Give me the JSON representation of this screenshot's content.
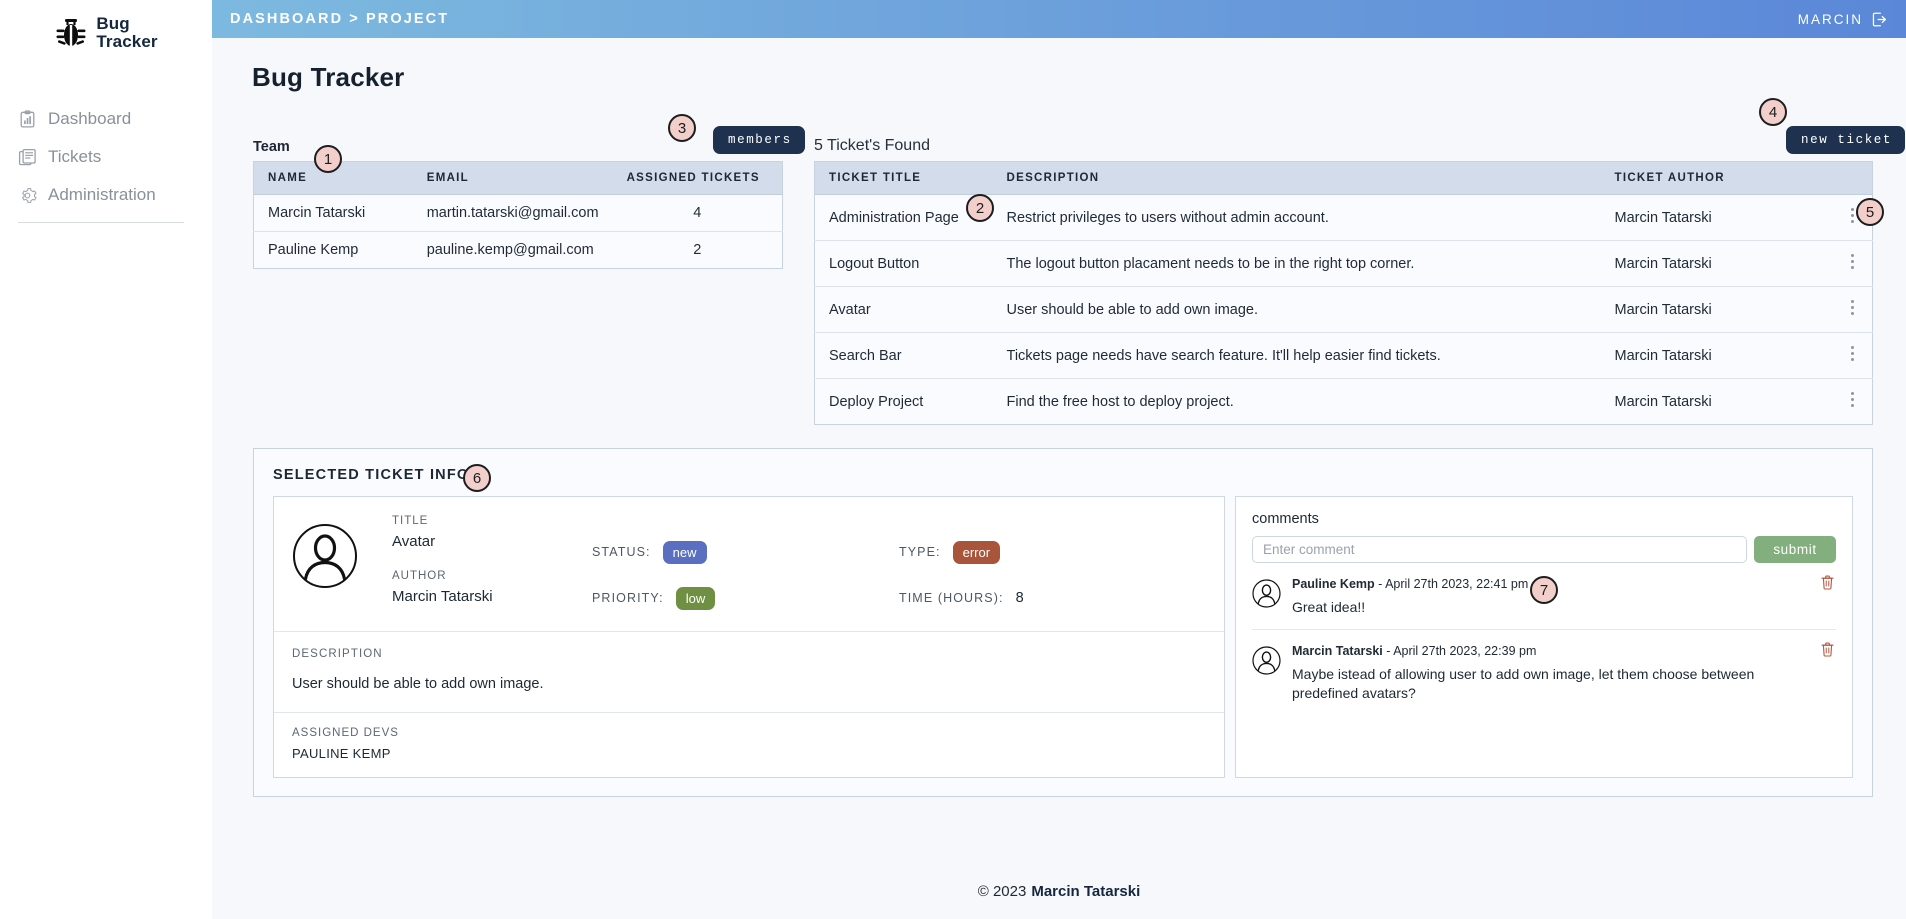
{
  "brand": {
    "line1": "Bug",
    "line2": "Tracker",
    "icon": "bug-icon"
  },
  "sidebar": {
    "items": [
      {
        "label": "Dashboard",
        "icon": "dashboard-chart-icon"
      },
      {
        "label": "Tickets",
        "icon": "ticket-list-icon"
      },
      {
        "label": "Administration",
        "icon": "gear-icon"
      }
    ]
  },
  "topbar": {
    "breadcrumb": "DASHBOARD > PROJECT",
    "user": "MARCIN",
    "logout_icon": "logout-icon",
    "gradient_from": "#7cb9e0",
    "gradient_to": "#5b87d8"
  },
  "page": {
    "title": "Bug Tracker"
  },
  "team": {
    "label": "Team",
    "members_button": "members",
    "columns": [
      "NAME",
      "EMAIL",
      "ASSIGNED TICKETS"
    ],
    "rows": [
      {
        "name": "Marcin Tatarski",
        "email": "martin.tatarski@gmail.com",
        "assigned": "4"
      },
      {
        "name": "Pauline Kemp",
        "email": "pauline.kemp@gmail.com",
        "assigned": "2"
      }
    ]
  },
  "tickets": {
    "heading": "5 Ticket's Found",
    "new_ticket_button": "new ticket",
    "columns": [
      "TICKET TITLE",
      "DESCRIPTION",
      "TICKET AUTHOR"
    ],
    "rows": [
      {
        "title": "Administration Page",
        "description": "Restrict privileges to users without admin account.",
        "author": "Marcin Tatarski"
      },
      {
        "title": "Logout Button",
        "description": "The logout button placament needs to be in the right top corner.",
        "author": "Marcin Tatarski"
      },
      {
        "title": "Avatar",
        "description": "User should be able to add own image.",
        "author": "Marcin Tatarski"
      },
      {
        "title": "Search Bar",
        "description": "Tickets page needs have search feature. It'll help easier find tickets.",
        "author": "Marcin Tatarski"
      },
      {
        "title": "Deploy Project",
        "description": "Find the free host to deploy project.",
        "author": "Marcin Tatarski"
      }
    ]
  },
  "selected_ticket": {
    "section_title": "SELECTED TICKET INFO",
    "avatar_icon": "user-avatar-icon",
    "title_label": "TITLE",
    "title_value": "Avatar",
    "author_label": "AUTHOR",
    "author_value": "Marcin Tatarski",
    "status_label": "STATUS:",
    "status_value": "new",
    "status_color": "#5a6fc0",
    "type_label": "TYPE:",
    "type_value": "error",
    "type_color": "#a8553b",
    "priority_label": "PRIORITY:",
    "priority_value": "low",
    "priority_color": "#6f8f42",
    "time_label": "TIME (HOURS):",
    "time_value": "8",
    "description_label": "DESCRIPTION",
    "description_value": "User should be able to add own image.",
    "devs_label": "ASSIGNED DEVS",
    "devs_value": "PAULINE KEMP"
  },
  "comments": {
    "label": "comments",
    "input_placeholder": "Enter comment",
    "input_value": "",
    "submit_label": "submit",
    "submit_color": "#83ae7e",
    "delete_icon": "trash-icon",
    "items": [
      {
        "author": "Pauline Kemp",
        "meta": " - April 27th 2023, 22:41 pm",
        "text": "Great idea!!"
      },
      {
        "author": "Marcin Tatarski",
        "meta": " - April 27th 2023, 22:39 pm",
        "text": "Maybe istead of allowing user to add own image, let them choose between predefined avatars?"
      }
    ]
  },
  "footer": {
    "copy": "© 2023",
    "name": "Marcin Tatarski"
  },
  "annotations": [
    {
      "n": "1"
    },
    {
      "n": "2"
    },
    {
      "n": "3"
    },
    {
      "n": "4"
    },
    {
      "n": "5"
    },
    {
      "n": "6"
    },
    {
      "n": "7"
    }
  ]
}
